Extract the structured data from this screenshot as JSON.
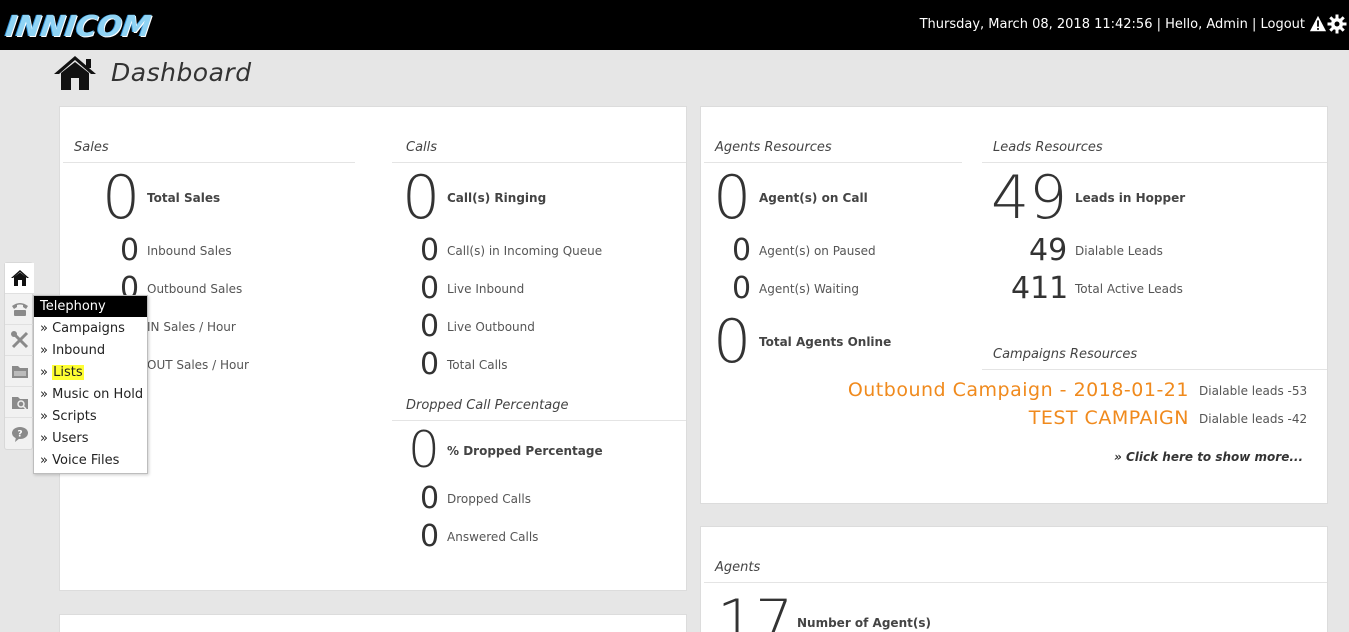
{
  "header": {
    "logo": "INNICOM",
    "datetime": "Thursday, March 08, 2018 11:42:56",
    "sep1": "|",
    "greeting": "Hello, Admin",
    "sep2": "|",
    "logout": "Logout"
  },
  "page": {
    "title": "Dashboard"
  },
  "sales": {
    "title": "Sales",
    "total_value": "0",
    "total_label": "Total Sales",
    "inbound_value": "0",
    "inbound_label": "Inbound Sales",
    "outbound_value": "0",
    "outbound_label": "Outbound Sales",
    "in_hour_label": "IN Sales / Hour",
    "out_hour_label": "OUT Sales / Hour"
  },
  "calls": {
    "title": "Calls",
    "ringing_value": "0",
    "ringing_label": "Call(s) Ringing",
    "queue_value": "0",
    "queue_label": "Call(s) in Incoming Queue",
    "live_in_value": "0",
    "live_in_label": "Live Inbound",
    "live_out_value": "0",
    "live_out_label": "Live Outbound",
    "total_value": "0",
    "total_label": "Total Calls"
  },
  "dropped": {
    "title": "Dropped Call Percentage",
    "pct_value": "0",
    "pct_label": "% Dropped Percentage",
    "dropped_value": "0",
    "dropped_label": "Dropped Calls",
    "answered_value": "0",
    "answered_label": "Answered Calls"
  },
  "agents_resources": {
    "title": "Agents Resources",
    "on_call_value": "0",
    "on_call_label": "Agent(s) on Call",
    "paused_value": "0",
    "paused_label": "Agent(s) on Paused",
    "waiting_value": "0",
    "waiting_label": "Agent(s) Waiting",
    "online_value": "0",
    "online_label": "Total Agents Online"
  },
  "leads_resources": {
    "title": "Leads Resources",
    "hopper_value": "49",
    "hopper_label": "Leads in Hopper",
    "dialable_value": "49",
    "dialable_label": "Dialable Leads",
    "active_value": "411",
    "active_label": "Total Active Leads"
  },
  "campaigns_resources": {
    "title": "Campaigns Resources",
    "items": [
      {
        "name": "Outbound Campaign - 2018-01-21",
        "leads": "Dialable leads -53"
      },
      {
        "name": "TEST CAMPAIGN",
        "leads": "Dialable leads -42"
      }
    ],
    "show_more": "» Click here to show more..."
  },
  "agents": {
    "title": "Agents",
    "count_value": "17",
    "count_label": "Number of Agent(s)"
  },
  "sidebar": {
    "items": [
      "home-icon",
      "telephone-icon",
      "tools-icon",
      "folder-icon",
      "folder-search-icon",
      "help-icon"
    ]
  },
  "telephony_menu": {
    "title": "Telephony",
    "bullet": "»",
    "items": [
      "Campaigns",
      "Inbound",
      "Lists",
      "Music on Hold",
      "Scripts",
      "Users",
      "Voice Files"
    ]
  },
  "colors": {
    "accent": "#f08a1d",
    "highlight": "#ffff33",
    "topbar": "#000000"
  }
}
